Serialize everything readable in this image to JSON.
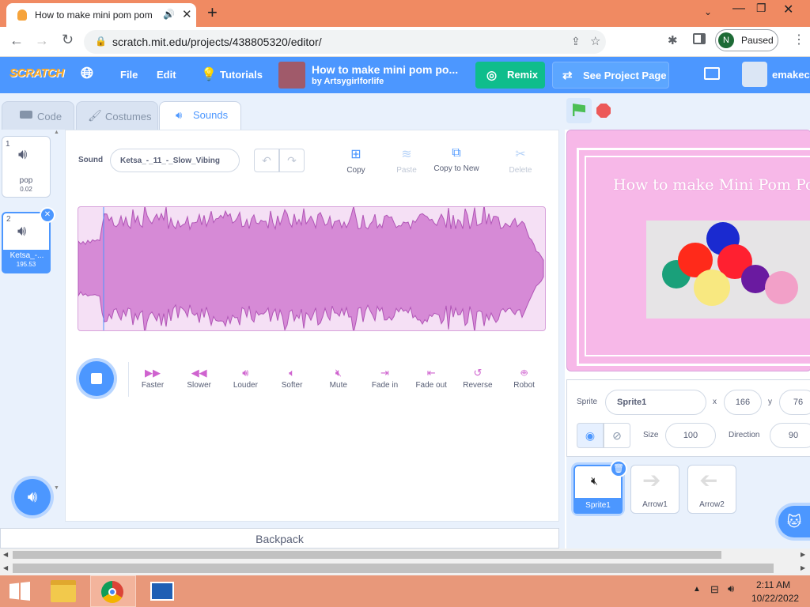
{
  "browser": {
    "tab_title": "How to make mini pom pom",
    "url": "scratch.mit.edu/projects/438805320/editor/",
    "profile_initial": "N",
    "profile_status": "Paused"
  },
  "menubar": {
    "logo": "SCRATCH",
    "file": "File",
    "edit": "Edit",
    "tutorials": "Tutorials",
    "project_title": "How to make mini pom po...",
    "project_author": "by Artsygirlforlife",
    "remix": "Remix",
    "see_project_page": "See Project Page",
    "username": "emakece"
  },
  "editor_tabs": {
    "code": "Code",
    "costumes": "Costumes",
    "sounds": "Sounds"
  },
  "sounds": [
    {
      "index": "1",
      "name": "pop",
      "duration": "0.02"
    },
    {
      "index": "2",
      "name": "Ketsa_-...",
      "duration": "195.53"
    }
  ],
  "sound_editor": {
    "sound_label": "Sound",
    "sound_name": "Ketsa_-_11_-_Slow_Vibing",
    "copy": "Copy",
    "paste": "Paste",
    "copy_to_new": "Copy to New",
    "delete": "Delete"
  },
  "effects": [
    "Faster",
    "Slower",
    "Louder",
    "Softer",
    "Mute",
    "Fade in",
    "Fade out",
    "Reverse",
    "Robot"
  ],
  "backpack": "Backpack",
  "stage": {
    "title": "How to make Mini Pom Po"
  },
  "sprite_info": {
    "sprite_label": "Sprite",
    "sprite_name": "Sprite1",
    "x_label": "x",
    "x": "166",
    "y_label": "y",
    "y": "76",
    "size_label": "Size",
    "size": "100",
    "direction_label": "Direction",
    "direction": "90"
  },
  "sprites": [
    {
      "name": "Sprite1"
    },
    {
      "name": "Arrow1"
    },
    {
      "name": "Arrow2"
    }
  ],
  "taskbar": {
    "time": "2:11 AM",
    "date": "10/22/2022"
  },
  "colors": {
    "scratch_blue": "#4c97ff",
    "remix_green": "#0fbd8c",
    "waveform": "#d68ad6",
    "browser_accent": "#f08a62"
  }
}
